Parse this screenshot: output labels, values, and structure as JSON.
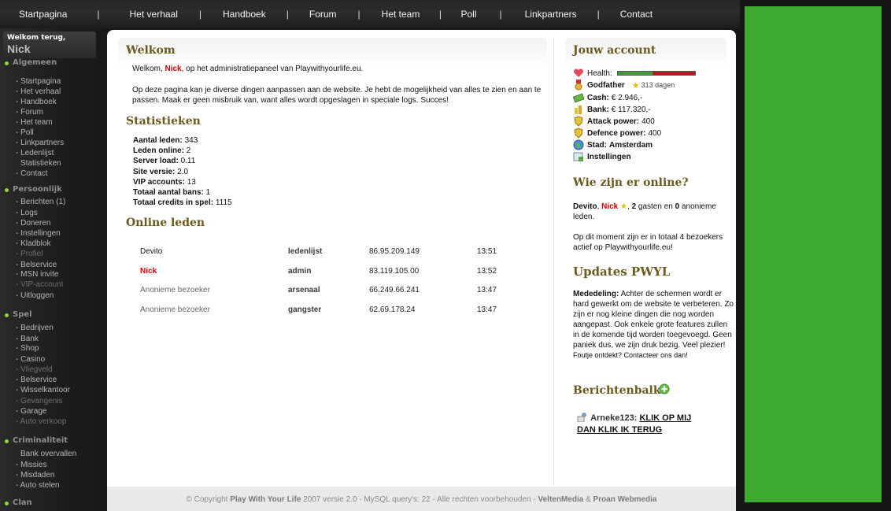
{
  "nav": {
    "items": [
      "Startpagina",
      "Het verhaal",
      "Handboek",
      "Forum",
      "Het team",
      "Poll",
      "Linkpartners",
      "Contact"
    ],
    "separator": "|"
  },
  "sidebar": {
    "welcome": "Welkom terug,",
    "user": "Nick",
    "sections": [
      {
        "title": "Algemeen",
        "links": [
          "- Startpagina",
          "- Het verhaal",
          "- Handboek",
          "- Forum",
          "- Het team",
          "- Poll",
          "- Linkpartners",
          "- Ledenlijst",
          "Statistieken",
          "- Contact"
        ]
      },
      {
        "title": "Persoonlijk",
        "links": [
          "- Berichten (1)",
          "- Logs",
          "- Doneren",
          "- Instellingen",
          "- Kladblok",
          "- Profiel",
          "- Belservice",
          "- MSN invite",
          "- VIP-account",
          "- Uitloggen"
        ]
      },
      {
        "title": "Spel",
        "links": [
          "- Bedrijven",
          "- Bank",
          "- Shop",
          "- Casino",
          "- Vliegveld",
          "- Belservice",
          "- Wisselkantoor",
          "- Gevangenis",
          "- Garage",
          "- Auto verkoop"
        ]
      },
      {
        "title": "Criminaliteit",
        "links": [
          "Bank overvallen",
          "- Missies",
          "- Misdaden",
          "- Auto stelen"
        ]
      },
      {
        "title": "Clan",
        "links": []
      }
    ]
  },
  "main": {
    "welcome": {
      "title": "Welkom",
      "line1_pre": "Welkom, ",
      "line1_user": "Nick",
      "line1_post": ", op het administratiepaneel van Playwithyourlife.eu.",
      "paragraph": "Op deze pagina kan je diverse dingen aanpassen aan de website. Je hebt de mogelijkheid van alles te zien en aan te passen. Maak er geen misbruik van, want alles wordt opgeslagen in speciale logs. Succes!"
    },
    "stats": {
      "title": "Statistieken",
      "rows": [
        {
          "label": "Aantal leden:",
          "value": "343"
        },
        {
          "label": "Leden online:",
          "value": "2"
        },
        {
          "label": "Server load:",
          "value": "0.11"
        },
        {
          "label": "Site versie:",
          "value": "2.0"
        },
        {
          "label": "VIP accounts:",
          "value": "13"
        },
        {
          "label": "Totaal aantal bans:",
          "value": "1"
        },
        {
          "label": "Totaal credits in spel:",
          "value": "1115"
        }
      ]
    },
    "online": {
      "title": "Online leden",
      "rows": [
        {
          "name": "Devito",
          "place": "ledenlijst",
          "ip": "86.95.209.149",
          "time": "13:51"
        },
        {
          "name": "Nick",
          "place": "admin",
          "ip": "83.119.105.00",
          "time": "13:52"
        },
        {
          "name": "Anonieme bezoeker",
          "place": "arsenaal",
          "ip": "66.249.66.241",
          "time": "13:47"
        },
        {
          "name": "Anonieme bezoeker",
          "place": "gangster",
          "ip": "62.69.178.24",
          "time": "13:47"
        }
      ]
    }
  },
  "account": {
    "title": "Jouw account",
    "health_label": "Health:",
    "health_fill": 0.45,
    "rank": "Godfather",
    "rank_days": "313 dagen",
    "cash_label": "Cash:",
    "cash": "€ 2.946,-",
    "bank_label": "Bank:",
    "bank": "€ 117.320,-",
    "attack_label": "Attack power:",
    "attack": "400",
    "defence_label": "Defence power:",
    "defence": "400",
    "city_label": "Stad:",
    "city": "Amsterdam",
    "settings": "Instellingen"
  },
  "who_online": {
    "title": "Wie zijn er online?",
    "user1": "Devito",
    "user2": "Nick",
    "guests": "2",
    "anon": "0",
    "text_mid": " gasten en ",
    "text_end": " anonieme leden.",
    "summary": "Op dit moment zijn er in totaal 4 bezoekers actief op Playwithyourlife.eu!"
  },
  "updates": {
    "title": "Updates PWYL",
    "label": "Mededeling:",
    "text": "Achter de schermen wordt er hard gewerkt om de website te verbeteren. Zo zijn er nog kleine dingen die nog worden aangepast. Ook enkele grote features zullen in de komende tijd worden toegevoegd. Geen paniek dus, we zijn druk bezig. Veel plezier!",
    "small": "Foutje ontdekt? Contacteer ons dan!"
  },
  "messages": {
    "title": "Berichtenbalk",
    "author": "Arneke123:",
    "text": "KLIK OP MIJ DAN KLIK IK TERUG"
  },
  "footer": {
    "pre": "© Copyright ",
    "site": "Play With Your Life",
    "mid": " 2007 versie 2.0 - MySQL query's: 22 - Alle rechten voorbehouden - ",
    "dev1": "VeltenMedia",
    "amp": " & ",
    "dev2": "Proan Webmedia"
  },
  "colors": {
    "accent_title": "#6b5a1f",
    "highlight_red": "#d40000",
    "side_panel": "#3daa2f"
  }
}
